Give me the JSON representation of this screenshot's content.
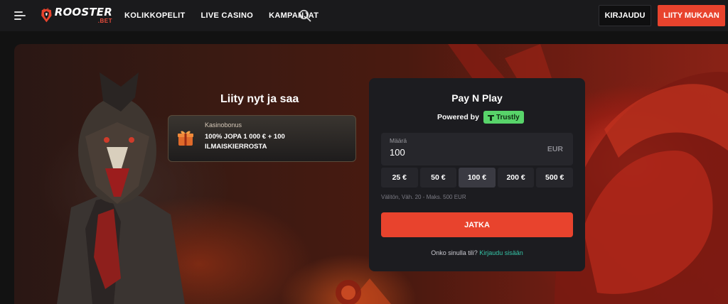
{
  "header": {
    "logo_word": "ROOSTER",
    "logo_sub": ".BET",
    "nav": [
      "KOLIKKOPELIT",
      "LIVE CASINO",
      "KAMPANJAT"
    ],
    "login_label": "KIRJAUDU",
    "join_label": "LIITY MUKAAN",
    "accent_color": "#e8432d"
  },
  "hero": {
    "title": "Liity nyt ja saa",
    "bonus": {
      "label": "Kasinobonus",
      "text": "100% JOPA 1 000 € + 100 ILMAISKIERROSTA"
    }
  },
  "paynplay": {
    "title": "Pay N Play",
    "powered_label": "Powered by",
    "provider": "Trustly",
    "amount_label": "Määrä",
    "amount_value": "100",
    "currency": "EUR",
    "presets": [
      "25 €",
      "50 €",
      "100 €",
      "200 €",
      "500 €"
    ],
    "selected_preset": "100 €",
    "range_note": "Välitön, Väh. 20 - Maks. 500 EUR",
    "continue_label": "JATKA",
    "account_question": "Onko sinulla tili?",
    "account_link": "Kirjaudu sisään"
  },
  "icons": {
    "menu": "hamburger-menu-icon",
    "search": "search-icon",
    "bonus": "gift-box-icon",
    "provider": "trustly-logo-icon"
  }
}
